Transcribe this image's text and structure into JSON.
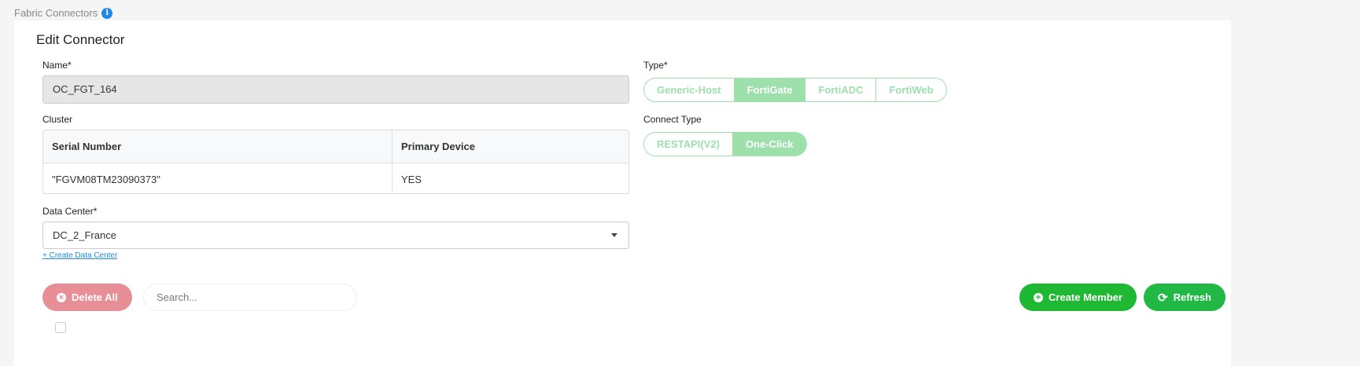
{
  "breadcrumb": {
    "title": "Fabric Connectors",
    "info_icon": "i"
  },
  "form": {
    "title": "Edit Connector",
    "name_label": "Name*",
    "name_value": "OC_FGT_164",
    "cluster_label": "Cluster",
    "cluster_table": {
      "headers": [
        "Serial Number",
        "Primary Device"
      ],
      "rows": [
        [
          "\"FGVM08TM23090373\"",
          "YES"
        ]
      ]
    },
    "datacenter_label": "Data Center*",
    "datacenter_value": "DC_2_France",
    "create_datacenter_link": "+ Create Data Center",
    "type_label": "Type*",
    "type_options": [
      "Generic-Host",
      "FortiGate",
      "FortiADC",
      "FortiWeb"
    ],
    "type_selected": "FortiGate",
    "connect_type_label": "Connect Type",
    "connect_type_options": [
      "RESTAPI(V2)",
      "One-Click"
    ],
    "connect_type_selected": "One-Click"
  },
  "toolbar": {
    "delete_all": "Delete All",
    "search_placeholder": "Search...",
    "create_member": "Create Member",
    "refresh": "Refresh"
  },
  "colors": {
    "green": "#1fb832",
    "light_green": "#9de0ac",
    "delete": "#e88e96",
    "link": "#1e88e5"
  }
}
